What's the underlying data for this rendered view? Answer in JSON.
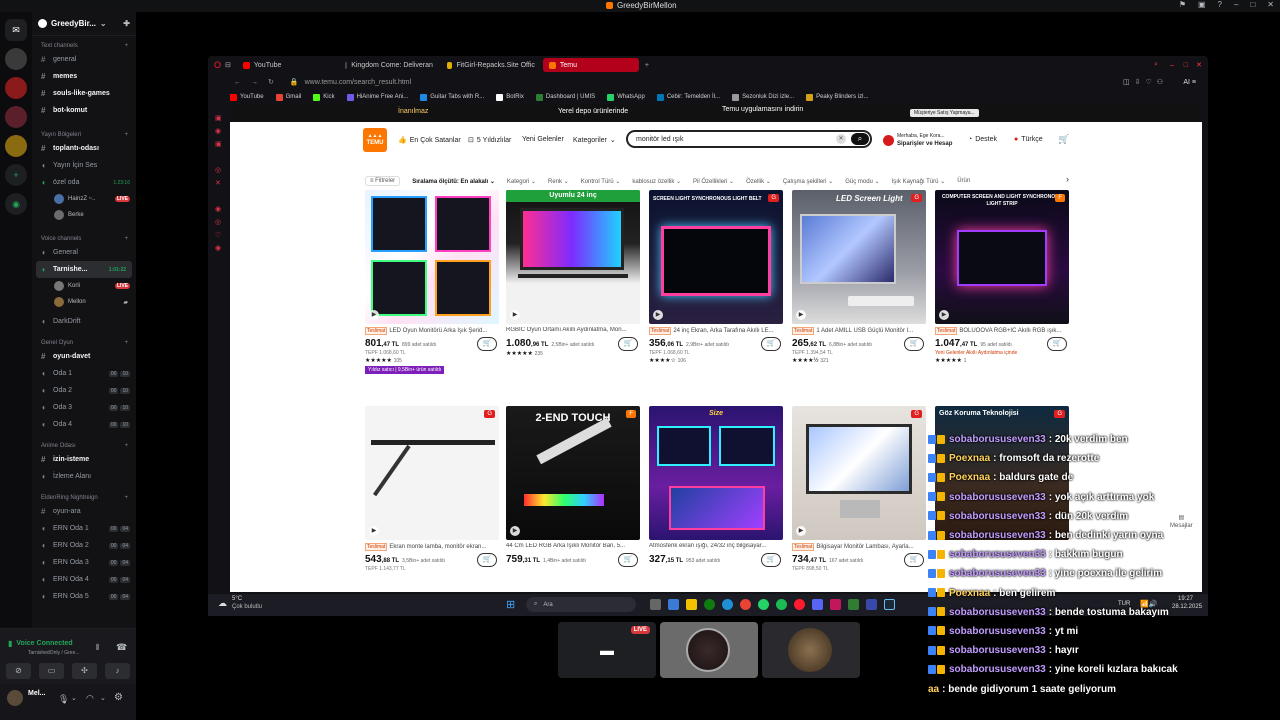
{
  "window_title": "GreedyBirMellon",
  "server": {
    "name": "GreedyBir..."
  },
  "channels": {
    "text_cat": "Text channels",
    "text": [
      "general",
      "memes",
      "souls-like-games",
      "bot-komut"
    ],
    "yayin_cat": "Yayın Bölgeleri",
    "yayin": [
      {
        "name": "toplantı-odası",
        "type": "text"
      },
      {
        "name": "Yayın İçin Ses",
        "type": "voice"
      },
      {
        "name": "özel oda",
        "type": "voice",
        "time": "1:23:16"
      }
    ],
    "ozel_users": [
      {
        "name": "HainzZ ~..",
        "live": "LIVE"
      },
      {
        "name": "Berke"
      }
    ],
    "voice_cat": "Voice channels",
    "voice_general": "General",
    "tarnished": {
      "name": "Tarnishe...",
      "time": "1:01:22"
    },
    "tarnished_users": [
      {
        "name": "Korli",
        "live": "LIVE"
      },
      {
        "name": "Mellon"
      }
    ],
    "darkdrift": "DarkDrift",
    "genel_cat": "Genel Oyun",
    "oyun_davet": "oyun-davet",
    "rooms": [
      {
        "name": "Oda 1",
        "a": "00",
        "b": "10"
      },
      {
        "name": "Oda 2",
        "a": "00",
        "b": "10"
      },
      {
        "name": "Oda 3",
        "a": "00",
        "b": "10"
      },
      {
        "name": "Oda 4",
        "a": "00",
        "b": "10"
      }
    ],
    "anime_cat": "Anime Odası",
    "izin_isteme": "izin-isteme",
    "izleme": "İzleme Alanı",
    "elden_cat": "EldenRing Nightreign",
    "oyun_ara": "oyun-ara",
    "ern": [
      {
        "name": "ERN Oda 1",
        "a": "00",
        "b": "04"
      },
      {
        "name": "ERN Oda 2",
        "a": "00",
        "b": "04"
      },
      {
        "name": "ERN Oda 3",
        "a": "00",
        "b": "04"
      },
      {
        "name": "ERN Oda 4",
        "a": "00",
        "b": "04"
      },
      {
        "name": "ERN Oda 5",
        "a": "00",
        "b": "04"
      }
    ]
  },
  "voice": {
    "status": "Voice Connected",
    "sub": "TarnishedOnly / Gree..."
  },
  "user": {
    "name": "Mel..."
  },
  "browser": {
    "tabs": [
      {
        "label": "YouTube",
        "color": "#ff0000"
      },
      {
        "label": "Kingdom Come: Deliveran",
        "color": "#444"
      },
      {
        "label": "FitGirl-Repacks.Site Offic",
        "color": "#e0b000"
      },
      {
        "label": "Temu",
        "color": "#fb7701"
      }
    ],
    "url": "www.temu.com/search_result.html",
    "bookmarks": [
      {
        "label": "YouTube",
        "color": "#ff0000"
      },
      {
        "label": "Gmail",
        "color": "#ea4335"
      },
      {
        "label": "Kick",
        "color": "#53fc18"
      },
      {
        "label": "HiAnime Free Ani...",
        "color": "#6c5ce7"
      },
      {
        "label": "Guitar Tabs with R...",
        "color": "#1e88e5"
      },
      {
        "label": "BotRix",
        "color": "#fff"
      },
      {
        "label": "Dashboard | UMIS",
        "color": "#2e7d32"
      },
      {
        "label": "WhatsApp",
        "color": "#25d366"
      },
      {
        "label": "Cebir: Temelden İl...",
        "color": "#0077b6"
      },
      {
        "label": "Sezonluk Dizi izle...",
        "color": "#999"
      },
      {
        "label": "Peaky Blinders izl...",
        "color": "#d4a017"
      }
    ]
  },
  "temu": {
    "promo_left": "İnanılmaz",
    "promo_mid": "Yerel depo ürünlerinde",
    "promo_right": "Temu uygulamasını indirin",
    "promo_badge": "Müşteriye Satış Yapmaya...",
    "logo": "TEMU",
    "nav": [
      "En Çok Satanlar",
      "5 Yıldızlılar",
      "Yeni Gelenler",
      "Kategoriler"
    ],
    "search": "monitör led ışık",
    "account_l1": "Merhaba, Ege Kora...",
    "account_l2": "Siparişler ve Hesap",
    "support": "Destek",
    "lang": "Türkçe",
    "filters": [
      "Filtreler",
      "Sıralama ölçütü: En alakalı",
      "Kategori",
      "Renk",
      "Kontrol Türü",
      "kablosuz özellik",
      "Pil Özellikleri",
      "Özellik",
      "Çalışma şekilleri",
      "Güç modu",
      "Işık Kaynağı Türü",
      "Ürün"
    ],
    "products": [
      {
        "title": "LED Oyun Monitörü Arka Işık Şerid...",
        "tag": "Teslimat",
        "price": "801",
        "cents": ",47 TL",
        "sold": "899 adet satıldı",
        "old": "TEPF 1.068,60 TL",
        "rating": "105",
        "promo": "Yıldız satıcı | 9,5Bin+ ürün satıldı"
      },
      {
        "title": "RGBIC Oyun Ortamı Akıllı Aydınlatma, Mon...",
        "tag": "",
        "price": "1.080",
        "cents": ",96 TL",
        "sold": "2,5Bin+ adet satıldı",
        "old": "",
        "rating": "235",
        "promo": ""
      },
      {
        "title": "24 inç Ekran, Arka Tarafına Akıllı LE...",
        "tag": "Teslimat",
        "price": "356",
        "cents": ",06 TL",
        "sold": "2,9Bin+ adet satıldı",
        "old": "TEPF 1.068,60 TL",
        "rating": "106",
        "promo": ""
      },
      {
        "title": "1 Adet AMILL USB Güçlü Monitör I...",
        "tag": "Teslimat",
        "price": "265",
        "cents": ",62 TL",
        "sold": "6,8Bin+ adet satıldı",
        "old": "TEPF 1.394,54 TL",
        "rating": "321",
        "promo": ""
      },
      {
        "title": "BOLUOOVA RGB+IC Akıllı RGB ışık...",
        "tag": "Teslimat",
        "price": "1.047",
        "cents": ",47 TL",
        "sold": "95 adet satıldı",
        "old": "Yeni Gelenler Akıllı Aydınlatma içinde",
        "rating": "1",
        "promo": ""
      },
      {
        "title": "Ekran monte lamba, monitör ekran...",
        "tag": "Teslimat",
        "price": "543",
        "cents": ",88 TL",
        "sold": "3,5Bin+ adet satıldı",
        "old": "TEPF 1.143,77 TL",
        "rating": "",
        "promo": ""
      },
      {
        "title": "44 Cm LED RGB Arka Işıklı Monitör Ban, 5...",
        "tag": "",
        "price": "759",
        "cents": ",31 TL",
        "sold": "1,4Bin+ adet satıldı",
        "old": "",
        "rating": "",
        "promo": ""
      },
      {
        "title": "Atmosferik ekran ışığı, 24/32 inç bilgisayar...",
        "tag": "",
        "price": "327",
        "cents": ",15 TL",
        "sold": "953 adet satıldı",
        "old": "",
        "rating": "",
        "promo": ""
      },
      {
        "title": "Bilgisayar Monitör Lambası, Ayarla...",
        "tag": "Teslimat",
        "price": "734",
        "cents": ",47 TL",
        "sold": "167 adet satıldı",
        "old": "TEPF 898,50 TL",
        "rating": "",
        "promo": ""
      },
      {
        "title": "Göz Koruma Teknolojisi",
        "tag": "",
        "price": "",
        "cents": "",
        "sold": "",
        "old": "",
        "rating": "",
        "promo": ""
      }
    ],
    "img_texts": [
      "",
      "Uyumlu 24 inç",
      "SCREEN LIGHT SYNCHRONOUS LIGHT BELT",
      "LED Screen Light",
      "COMPUTER SCREEN AND LIGHT SYNCHRONOUS LIGHT STRIP",
      "",
      "2-END TOUCH",
      "Size",
      "",
      ""
    ]
  },
  "taskbar": {
    "weather_temp": "5°C",
    "weather_desc": "Çok bulutlu",
    "search": "Ara",
    "lang": "TUR",
    "time": "19:27",
    "date": "28.12.2025"
  },
  "stream": {
    "live": "LIVE"
  },
  "chat": [
    {
      "user": "sobaborususeven33",
      "msg": ": 20k verdim ben",
      "c": "p"
    },
    {
      "user": "Poexnaa",
      "msg": ": fromsoft da rezerotte",
      "c": "y"
    },
    {
      "user": "Poexnaa",
      "msg": ": baldurs gate de",
      "c": "y"
    },
    {
      "user": "sobaborususeven33",
      "msg": ": yok açık arttırma yok",
      "c": "p"
    },
    {
      "user": "sobaborususeven33",
      "msg": ": dün 20k verdim",
      "c": "p"
    },
    {
      "user": "sobaborususeven33",
      "msg": ": ben dedinki yarın oyna",
      "c": "p"
    },
    {
      "user": "sobaborususeven33",
      "msg": ": bakkım bugun",
      "c": "p"
    },
    {
      "user": "sobaborususeven33",
      "msg": ": yine poexna ile gelirim",
      "c": "p"
    },
    {
      "user": "Poexnaa",
      "msg": ": ben gelirem",
      "c": "y"
    },
    {
      "user": "sobaborususeven33",
      "msg": ": bende tostuma bakayım",
      "c": "p"
    },
    {
      "user": "sobaborususeven33",
      "msg": ": yt mi",
      "c": "p"
    },
    {
      "user": "sobaborususeven33",
      "msg": ": hayır",
      "c": "p"
    },
    {
      "user": "sobaborususeven33",
      "msg": ": yine koreli kızlara bakıcak",
      "c": "p"
    },
    {
      "user": "aa",
      "msg": ": bende gidiyorum 1 saate geliyorum",
      "c": "y"
    }
  ]
}
